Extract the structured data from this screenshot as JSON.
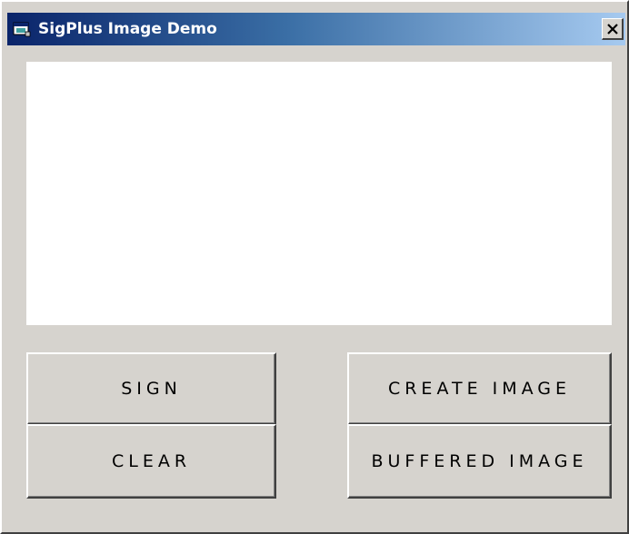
{
  "window": {
    "title": "SigPlus Image Demo",
    "icon": "app-window-icon",
    "close_label": "×"
  },
  "buttons": {
    "sign": "SIGN",
    "clear": "CLEAR",
    "create_image": "CREATE IMAGE",
    "buffered_image": "BUFFERED IMAGE"
  },
  "colors": {
    "window_bg": "#d6d3ce",
    "title_start": "#0a246a",
    "title_end": "#a6caf0",
    "signature_bg": "#ffffff"
  }
}
